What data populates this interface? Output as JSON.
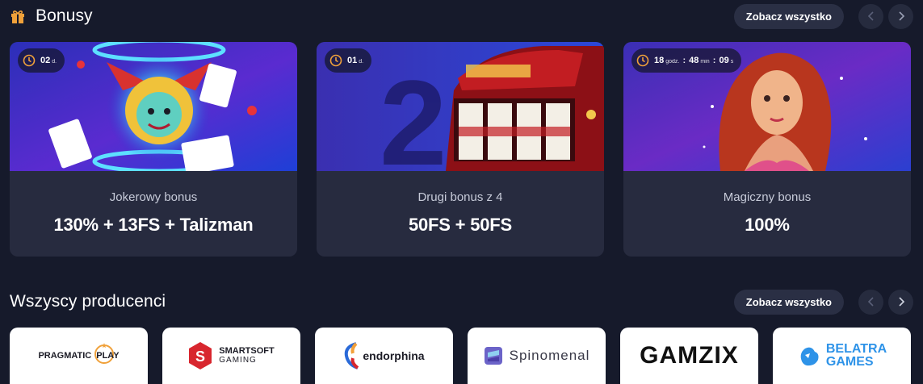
{
  "bonuses": {
    "title": "Bonusy",
    "see_all": "Zobacz wszystko",
    "cards": [
      {
        "timer": {
          "d": "02",
          "d_unit": "d."
        },
        "subtitle": "Jokerowy bonus",
        "value": "130% + 13FS + Talizman"
      },
      {
        "timer": {
          "d": "01",
          "d_unit": "d."
        },
        "subtitle": "Drugi bonus z 4",
        "value": "50FS + 50FS",
        "image_text": "2"
      },
      {
        "timer": {
          "h": "18",
          "h_unit": "godz.",
          "m": "48",
          "m_unit": "min",
          "s": "09",
          "s_unit": "s"
        },
        "subtitle": "Magiczny bonus",
        "value": "100%"
      }
    ]
  },
  "providers": {
    "title": "Wszyscy producenci",
    "see_all": "Zobacz wszystko",
    "items": [
      {
        "name_a": "PRAGMATIC",
        "name_b": "PLAY"
      },
      {
        "name_a": "SMARTSOFT",
        "name_b": "GAMING"
      },
      {
        "name_a": "endorphina"
      },
      {
        "name_a": "Spinomenal"
      },
      {
        "name_a": "GAMZIX"
      },
      {
        "name_a": "BELATRA",
        "name_b": "GAMES"
      }
    ]
  },
  "colors": {
    "bg": "#161a2b",
    "card": "#272b3f",
    "accent_orange": "#f0a13a",
    "pill": "#2a2f44"
  }
}
